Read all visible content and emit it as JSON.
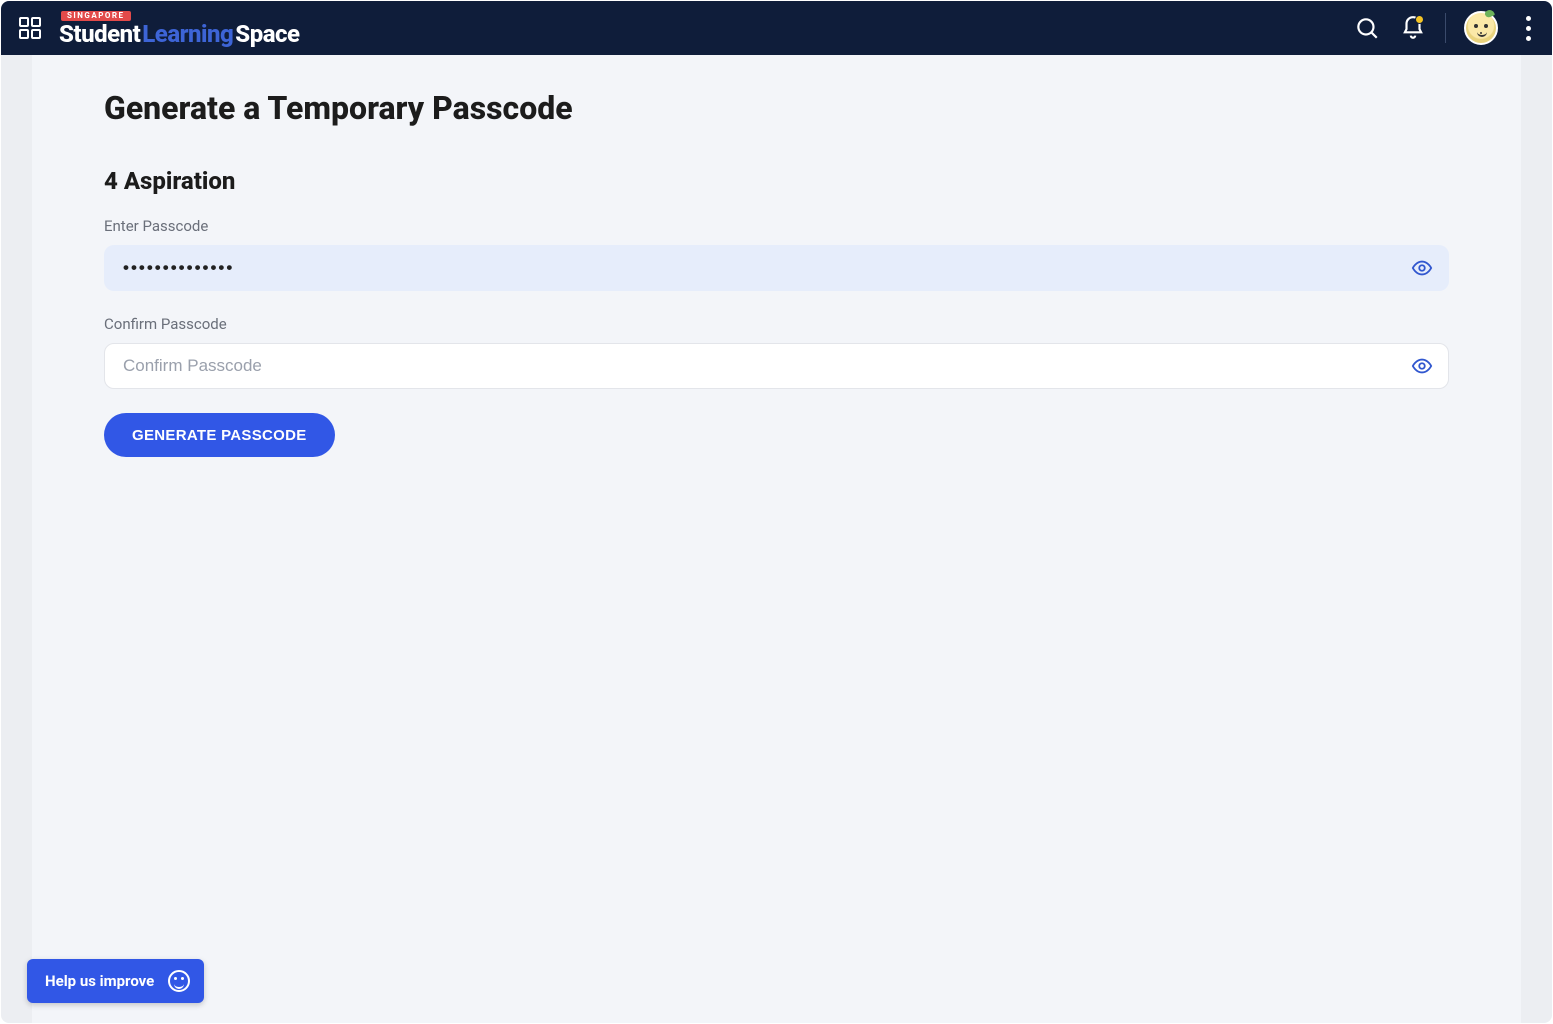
{
  "header": {
    "badge": "SINGAPORE",
    "logo_student": "Student",
    "logo_learning": "Learning",
    "logo_space": "Space"
  },
  "page": {
    "title": "Generate a Temporary Passcode",
    "section": "4 Aspiration",
    "enter": {
      "label": "Enter Passcode",
      "value": "••••••••••••••"
    },
    "confirm": {
      "label": "Confirm Passcode",
      "value": "",
      "placeholder": "Confirm Passcode"
    },
    "submit_label": "GENERATE PASSCODE"
  },
  "help": {
    "label": "Help us improve"
  }
}
